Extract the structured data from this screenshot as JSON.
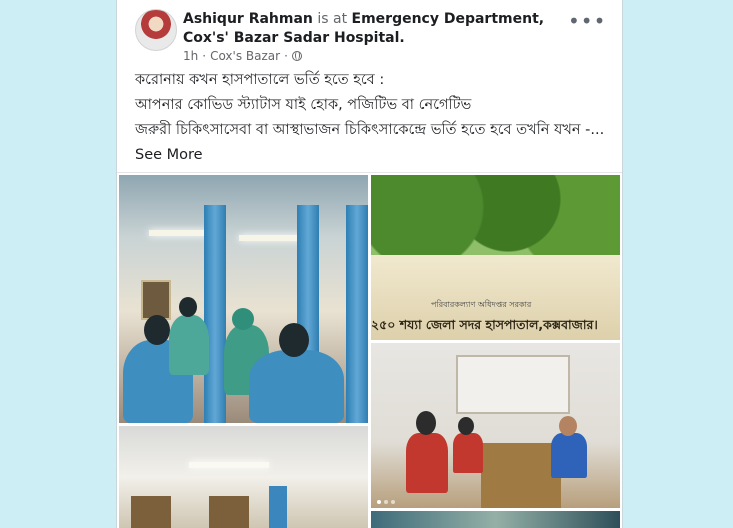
{
  "post": {
    "author": "Ashiqur Rahman",
    "connector": "is at",
    "place": "Emergency Department, Cox's' Bazar Sadar Hospital.",
    "time": "1h",
    "separator": "·",
    "location": "Cox's Bazar",
    "more_label": "•••",
    "lines": [
      "করোনায় কখন হাসপাতালে ভর্তি হতে হবে :",
      "আপনার কোভিড স্ট্যাটাস যাই হোক, পজিটিভ বা নেগেটিভ",
      "জরুরী চিকিৎসাসেবা বা আস্থাভাজন চিকিৎসাকেন্দ্রে ভর্তি হতে হবে তখনি যখন -..."
    ],
    "see_more": "See More"
  },
  "photos": {
    "sign_small": "পরিবারকল্যাণ অধিদপ্তর সরকার",
    "sign_main": "২৫০ শয্যা জেলা সদর হাসপাতাল,কক্সবাজার।"
  },
  "icons": {
    "privacy": "globe-icon",
    "menu": "more-icon"
  },
  "colors": {
    "background": "#cdeef4",
    "card": "#ffffff",
    "text": "#1c1e21",
    "muted": "#65676b"
  }
}
